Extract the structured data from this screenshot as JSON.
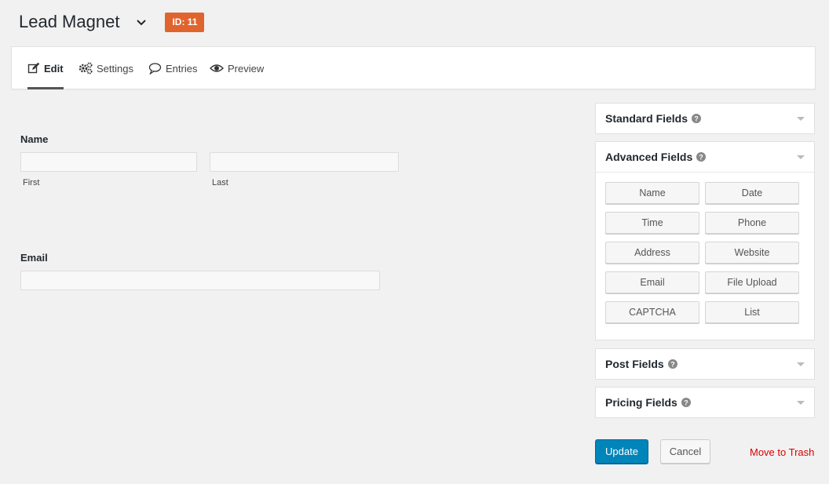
{
  "header": {
    "title": "Lead Magnet",
    "id_badge": "ID: 11"
  },
  "toolbar": {
    "tabs": [
      {
        "label": "Edit",
        "icon": "edit-icon",
        "active": true
      },
      {
        "label": "Settings",
        "icon": "settings-icon"
      },
      {
        "label": "Entries",
        "icon": "entries-icon"
      },
      {
        "label": "Preview",
        "icon": "preview-icon"
      }
    ]
  },
  "form": {
    "name_field": {
      "label": "Name",
      "first_sublabel": "First",
      "last_sublabel": "Last",
      "first_value": "",
      "last_value": ""
    },
    "email_field": {
      "label": "Email",
      "value": ""
    }
  },
  "sidebar": {
    "standard": {
      "title": "Standard Fields"
    },
    "advanced": {
      "title": "Advanced Fields",
      "buttons": [
        "Name",
        "Date",
        "Time",
        "Phone",
        "Address",
        "Website",
        "Email",
        "File Upload",
        "CAPTCHA",
        "List"
      ]
    },
    "post": {
      "title": "Post Fields"
    },
    "pricing": {
      "title": "Pricing Fields"
    }
  },
  "actions": {
    "update_label": "Update",
    "cancel_label": "Cancel",
    "trash_label": "Move to Trash"
  },
  "colors": {
    "accent": "#0085ba",
    "badge": "#e0642d",
    "danger": "#dc0000"
  }
}
